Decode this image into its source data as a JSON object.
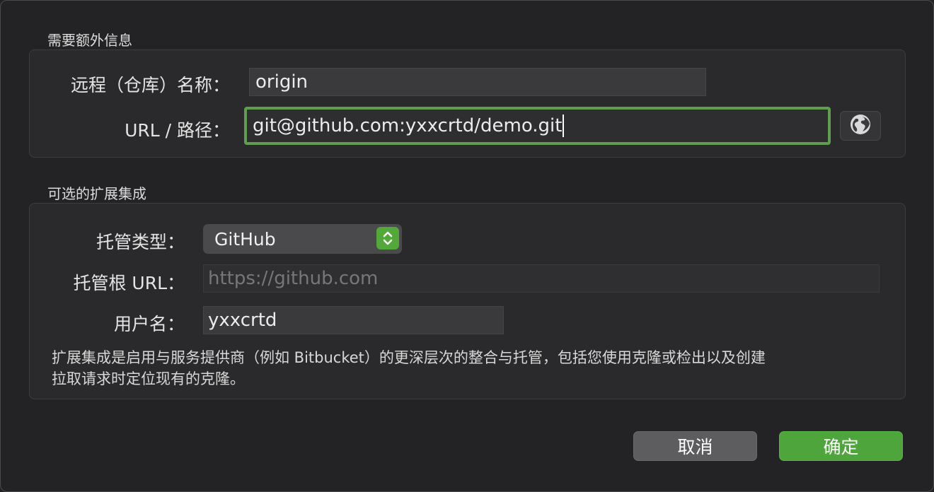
{
  "dialog": {
    "section_required": "需要额外信息",
    "section_optional": "可选的扩展集成"
  },
  "remote": {
    "name_label": "远程（仓库）名称：",
    "name_value": "origin",
    "url_label": "URL / 路径：",
    "url_value": "git@github.com:yxxcrtd/demo.git",
    "globe_icon": "globe-icon"
  },
  "integration": {
    "hosting_type_label": "托管类型：",
    "hosting_type_value": "GitHub",
    "root_url_label": "托管根 URL：",
    "root_url_placeholder": "https://github.com",
    "username_label": "用户名：",
    "username_value": "yxxcrtd",
    "note_line1": "扩展集成是启用与服务提供商（例如 Bitbucket）的更深层次的整合与托管，包括您使用克隆或检出以及创建",
    "note_line2": "拉取请求时定位现有的克隆。"
  },
  "buttons": {
    "cancel_label": "取消",
    "ok_label": "确定"
  },
  "colors": {
    "accent": "#4ea53c",
    "focus_ring": "#5e9e4e",
    "background": "#232325"
  }
}
